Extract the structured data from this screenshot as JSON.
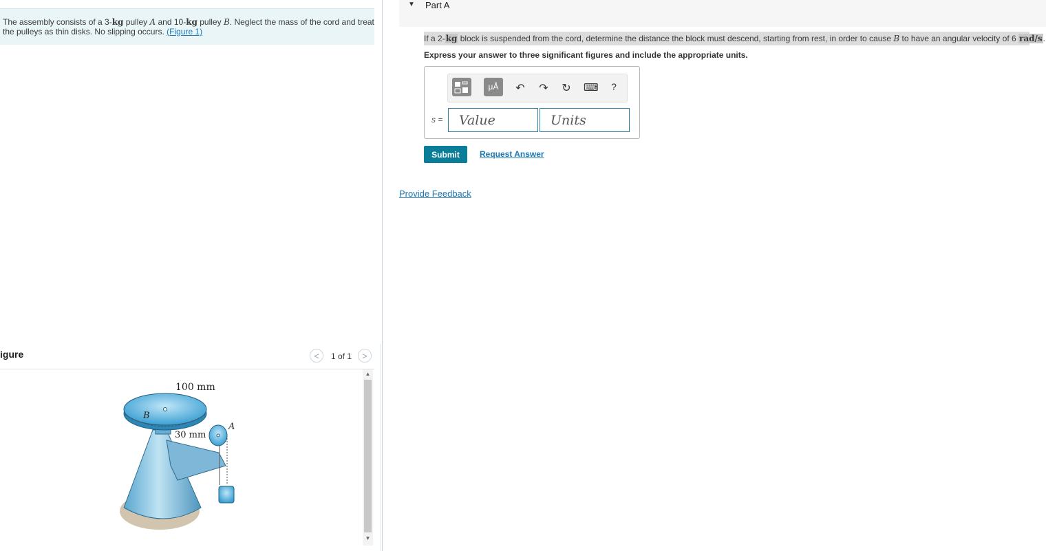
{
  "problem": {
    "text_1": "The assembly consists of a 3-",
    "unit_kg_1": "kg",
    "text_2": " pulley ",
    "var_a": "A",
    "text_3": " and 10-",
    "unit_kg_2": "kg",
    "text_4": " pulley ",
    "var_b": "B",
    "text_5": ". Neglect the mass of the cord and treat the pulleys as thin disks. No slipping occurs. ",
    "figure_link": "(Figure 1)"
  },
  "figure_panel": {
    "title": "igure",
    "pager_text": "1 of 1",
    "prev_glyph": "<",
    "next_glyph": ">",
    "labels": {
      "radius_b": "100 mm",
      "radius_a": "30 mm",
      "pulley_b": "B",
      "pulley_a": "A"
    },
    "scroll_up": "▲",
    "scroll_down": "▼"
  },
  "part": {
    "caret": "▼",
    "title": "Part A"
  },
  "question": {
    "text_1": "If a 2-",
    "unit_kg": "kg",
    "text_2": " block is suspended from the cord, determine the distance the block must descend, starting from rest, in order to cause ",
    "var_b": "B",
    "text_3": " to have an angular velocity of 6 ",
    "unit_rad": "rad/s",
    "text_4": ".",
    "instructions": "Express your answer to three significant figures and include the appropriate units."
  },
  "toolbar": {
    "templates_icon": "template-icon",
    "units_label": "μÅ",
    "undo_glyph": "↶",
    "redo_glyph": "↷",
    "reset_glyph": "↻",
    "keyboard_glyph": "⌨",
    "help_glyph": "?"
  },
  "answer": {
    "label": "s =",
    "value_placeholder": "Value",
    "units_placeholder": "Units"
  },
  "actions": {
    "submit": "Submit",
    "request_answer": "Request Answer",
    "feedback": "Provide Feedback"
  },
  "colors": {
    "accent": "#0a7d99",
    "link": "#1b78b5",
    "problem_bg": "#e9f5f6"
  }
}
